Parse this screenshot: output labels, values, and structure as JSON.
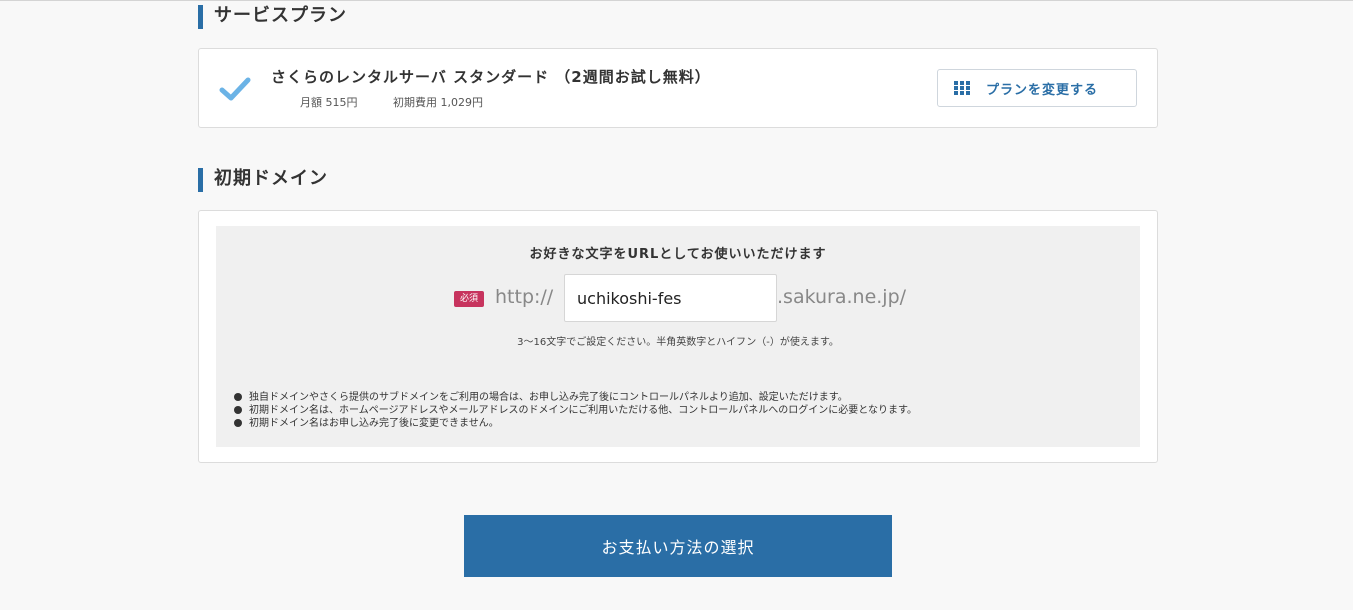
{
  "service_plan": {
    "heading": "サービスプラン",
    "plan_name": "さくらのレンタルサーバ スタンダード （2週間お試し無料）",
    "monthly_fee": "月額 515円",
    "initial_fee": "初期費用 1,029円",
    "change_button": "プランを変更する"
  },
  "initial_domain": {
    "heading": "初期ドメイン",
    "title": "お好きな文字をURLとしてお使いいただけます",
    "required_badge": "必須",
    "prefix": "http://",
    "input_value": "uchikoshi-fes",
    "suffix": ".sakura.ne.jp/",
    "hint": "3〜16文字でご設定ください。半角英数字とハイフン（-）が使えます。",
    "notes": [
      "独自ドメインやさくら提供のサブドメインをご利用の場合は、お申し込み完了後にコントロールパネルより追加、設定いただけます。",
      "初期ドメイン名は、ホームページアドレスやメールアドレスのドメインにご利用いただける他、コントロールパネルへのログインに必要となります。",
      "初期ドメイン名はお申し込み完了後に変更できません。"
    ]
  },
  "payment_button": "お支払い方法の選択",
  "colors": {
    "accent": "#2a6ea6",
    "check": "#6bb3e6",
    "required": "#c7345e"
  },
  "icons": {
    "plan_check": "check-icon",
    "change_plan": "grid-icon"
  }
}
